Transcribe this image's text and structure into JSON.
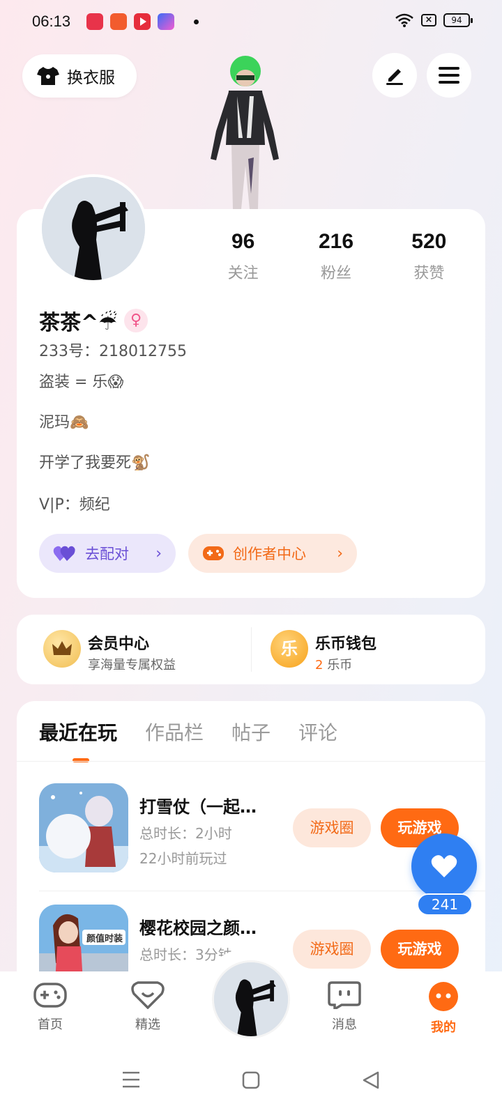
{
  "status_bar": {
    "time": "06:13",
    "battery": "94",
    "app_icons": [
      "record-app-icon",
      "shopping-app-icon",
      "video-app-icon",
      "vpn-app-icon"
    ]
  },
  "top_bar": {
    "outfit_label": "换衣服",
    "edit_icon": "edit-icon",
    "menu_icon": "menu-icon"
  },
  "profile": {
    "following_count": "96",
    "following_label": "关注",
    "fans_count": "216",
    "fans_label": "粉丝",
    "likes_count": "520",
    "likes_label": "获赞",
    "name": "茶茶^☔",
    "gender_symbol": "♀",
    "id_line": "233号：218012755",
    "bio_line1": "盗装 = 乐😱",
    "bio_line2": "泥玛🙈",
    "bio_line3": "开学了我要死🐒",
    "vip_line": "V|P：频纪",
    "pair_label": "去配对",
    "creator_label": "创作者中心"
  },
  "wallet": {
    "member_title": "会员中心",
    "member_sub": "享海量专属权益",
    "coin_title": "乐币钱包",
    "coin_amount": "2",
    "coin_unit": "乐币",
    "coin_glyph": "乐"
  },
  "tabs": [
    "最近在玩",
    "作品栏",
    "帖子",
    "评论"
  ],
  "games": [
    {
      "name": "打雪仗（一起…",
      "duration": "总时长：2小时",
      "last_played": "22小时前玩过",
      "circle_label": "游戏圈",
      "play_label": "玩游戏"
    },
    {
      "name": "樱花校园之颜…",
      "duration": "总时长：3分钟",
      "icon_text": "颜值时装",
      "circle_label": "游戏圈",
      "play_label": "玩游戏"
    }
  ],
  "like_fab": {
    "count": "241"
  },
  "bottom_nav": {
    "home": "首页",
    "featured": "精选",
    "messages": "消息",
    "mine": "我的"
  },
  "colors": {
    "accent_orange": "#ff6a13",
    "accent_blue": "#2f7ff2",
    "accent_purple": "#6a4fd6"
  }
}
